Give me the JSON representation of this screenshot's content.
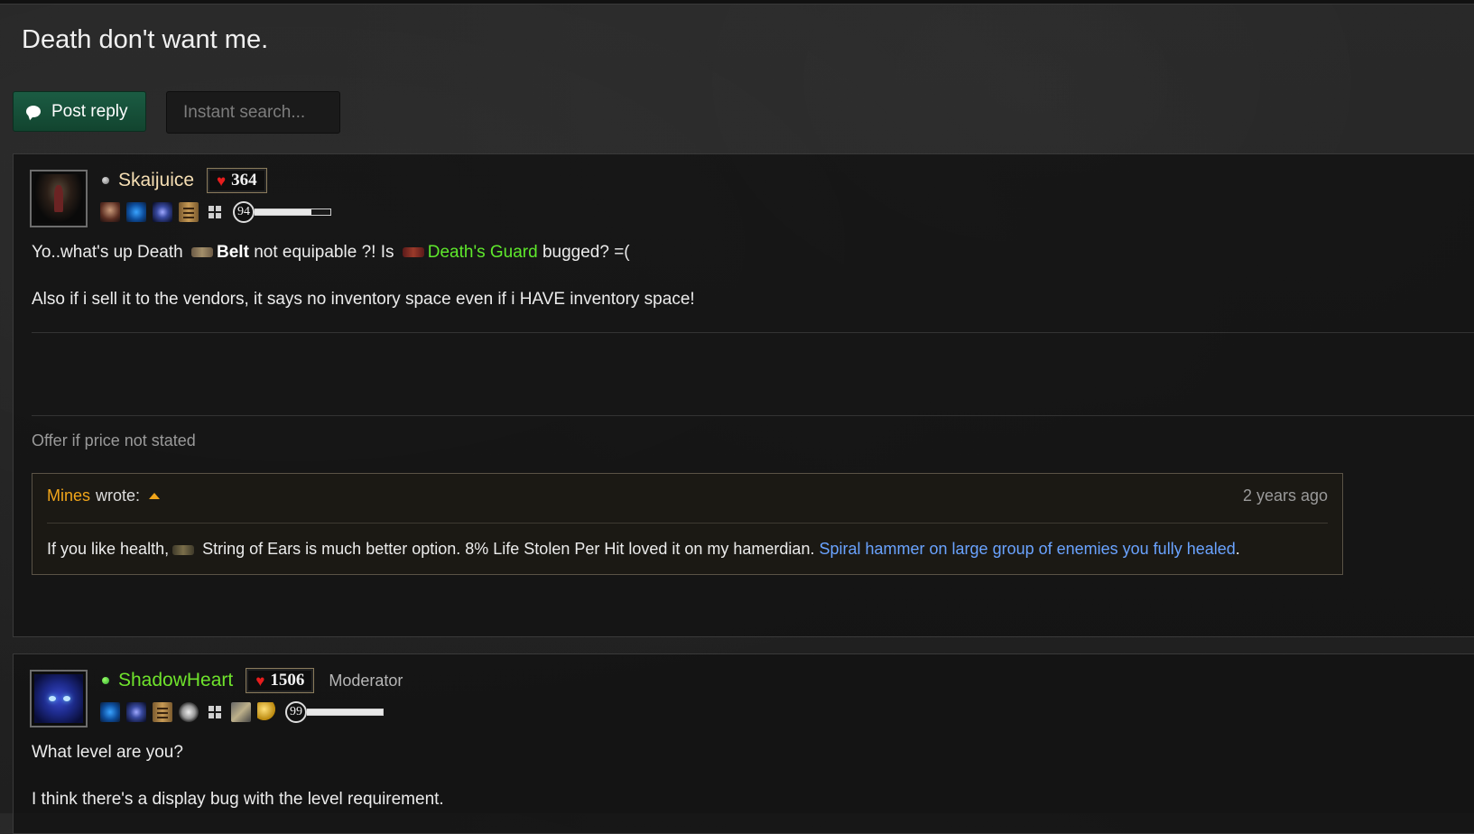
{
  "thread": {
    "title": "Death don't want me.",
    "post_reply_label": "Post reply",
    "search_placeholder": "Instant search..."
  },
  "posts": [
    {
      "username": "Skaijuice",
      "status": "offline",
      "reputation": "364",
      "level": "94",
      "level_progress": 0.75,
      "badges": [
        "portrait-badge",
        "blue-rune-badge",
        "purple-rune-badge",
        "scroll-badge",
        "windows-icon"
      ],
      "content": {
        "line1_prefix": "Yo..what's up Death",
        "belt_label": "Belt",
        "line1_mid": "not equipable ?! Is",
        "death_guard": "Death's Guard",
        "line1_suffix": "bugged? =(",
        "line2": "Also if i sell it to the vendors, it says no inventory space even if i HAVE inventory space!"
      },
      "signature": "Offer if price not stated",
      "quote": {
        "author": "Mines",
        "wrote": "wrote:",
        "time": "2 years ago",
        "body_prefix": "If you like health,",
        "body_item": "String of Ears",
        "body_mid": "is much better option. 8% Life Stolen Per Hit loved it on my hamerdian.",
        "body_link": "Spiral hammer on large group of enemies you fully healed",
        "body_end": "."
      }
    },
    {
      "username": "ShadowHeart",
      "status": "online",
      "reputation": "1506",
      "role": "Moderator",
      "level": "99",
      "level_progress": 1.0,
      "badges": [
        "blue-rune-badge",
        "purple-rune-badge",
        "scroll-badge",
        "steam-icon",
        "windows-icon",
        "tool-badge",
        "coins-badge"
      ],
      "content": {
        "line1": "What level are you?",
        "line2": "I think there's a display bug with the level requirement."
      }
    }
  ],
  "colors": {
    "accent_green": "#1b5c43",
    "set_item": "#5fe92c",
    "quote_author": "#f0a51a",
    "link": "#6aa3ff",
    "heart": "#e61d1d"
  }
}
